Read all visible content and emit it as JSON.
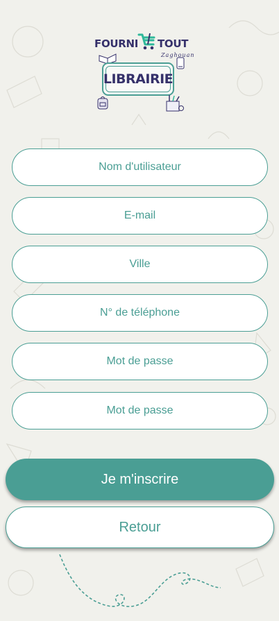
{
  "logo": {
    "brand_left": "FOURNI",
    "brand_right": "TOUT",
    "subtitle": "Zaghouan",
    "sign": "LIBRAIRIE"
  },
  "form": {
    "username_placeholder": "Nom d'utilisateur",
    "email_placeholder": "E-mail",
    "city_placeholder": "Ville",
    "phone_placeholder": "N° de téléphone",
    "password_placeholder": "Mot de passe",
    "confirm_password_placeholder": "Mot de passe"
  },
  "buttons": {
    "register": "Je m'inscrire",
    "back": "Retour"
  },
  "colors": {
    "accent": "#4a9e94",
    "brand_dark": "#36316b",
    "background": "#f1f1ec"
  }
}
